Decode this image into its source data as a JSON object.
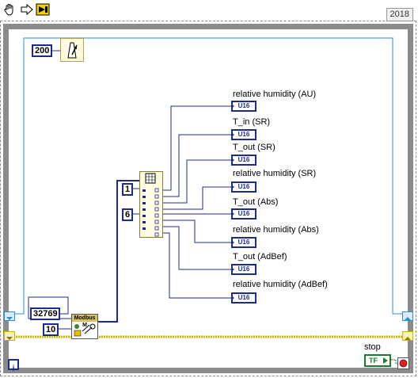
{
  "toolbar": {
    "tools": [
      "hand-tool-icon",
      "run-arrow-icon",
      "run-continuous-icon"
    ],
    "year": "2018"
  },
  "constants": {
    "wait_ms": "200",
    "register_address": "32769",
    "register_count": "10",
    "index_start": "1",
    "index_length": "6"
  },
  "nodes": {
    "modbus_label": "Modbus M"
  },
  "indicators": [
    {
      "label": "relative humidity (AU)",
      "type": "U16"
    },
    {
      "label": "T_in (SR)",
      "type": "U16"
    },
    {
      "label": "T_out (SR)",
      "type": "U16"
    },
    {
      "label": "relative humidity (SR)",
      "type": "U16"
    },
    {
      "label": "T_out (Abs)",
      "type": "U16"
    },
    {
      "label": "relative humidity (Abs)",
      "type": "U16"
    },
    {
      "label": "T_out (AdBef)",
      "type": "U16"
    },
    {
      "label": "relative humidity (AdBef)",
      "type": "U16"
    }
  ],
  "stop": {
    "label": "stop",
    "bool_text": "TF"
  },
  "loop": {
    "iteration_label": "i"
  },
  "colors": {
    "wire_blue": "#1c2b8f",
    "wire_light": "#2a8fd6",
    "error_wire": "#c8b400",
    "loop_border": "#8b8b8b"
  }
}
